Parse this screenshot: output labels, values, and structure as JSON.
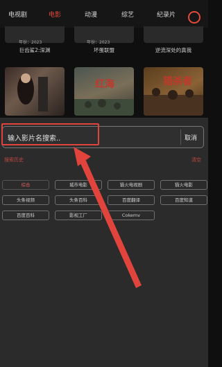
{
  "nav": {
    "tabs": [
      {
        "label": "电视剧"
      },
      {
        "label": "电影"
      },
      {
        "label": "动漫"
      },
      {
        "label": "综艺"
      },
      {
        "label": "纪录片"
      }
    ],
    "active_tab": "电影",
    "colors": {
      "accent": "#e24a3b"
    }
  },
  "row1": {
    "dates": [
      "年份：2023",
      "年份：2023"
    ],
    "captions": [
      "巨齿鲨2:深渊",
      "坏蛋联盟",
      "逆流深处的真我"
    ]
  },
  "posters": {
    "titles": [
      "",
      "红海",
      "猎杀者"
    ]
  },
  "search": {
    "placeholder": "输入影片名搜索..",
    "cancel_label": "取消",
    "history_label": "搜索历史",
    "clear_label": "清空"
  },
  "sources": [
    {
      "label": "综合",
      "selected": true
    },
    {
      "label": "城市电影"
    },
    {
      "label": "猫火电视剧"
    },
    {
      "label": "猫火电影"
    },
    {
      "label": "头条视频"
    },
    {
      "label": "头条百科"
    },
    {
      "label": "百度翻译"
    },
    {
      "label": "百度知道"
    },
    {
      "label": "百度百科"
    },
    {
      "label": "影视工厂"
    },
    {
      "label": "Cokemv"
    }
  ]
}
